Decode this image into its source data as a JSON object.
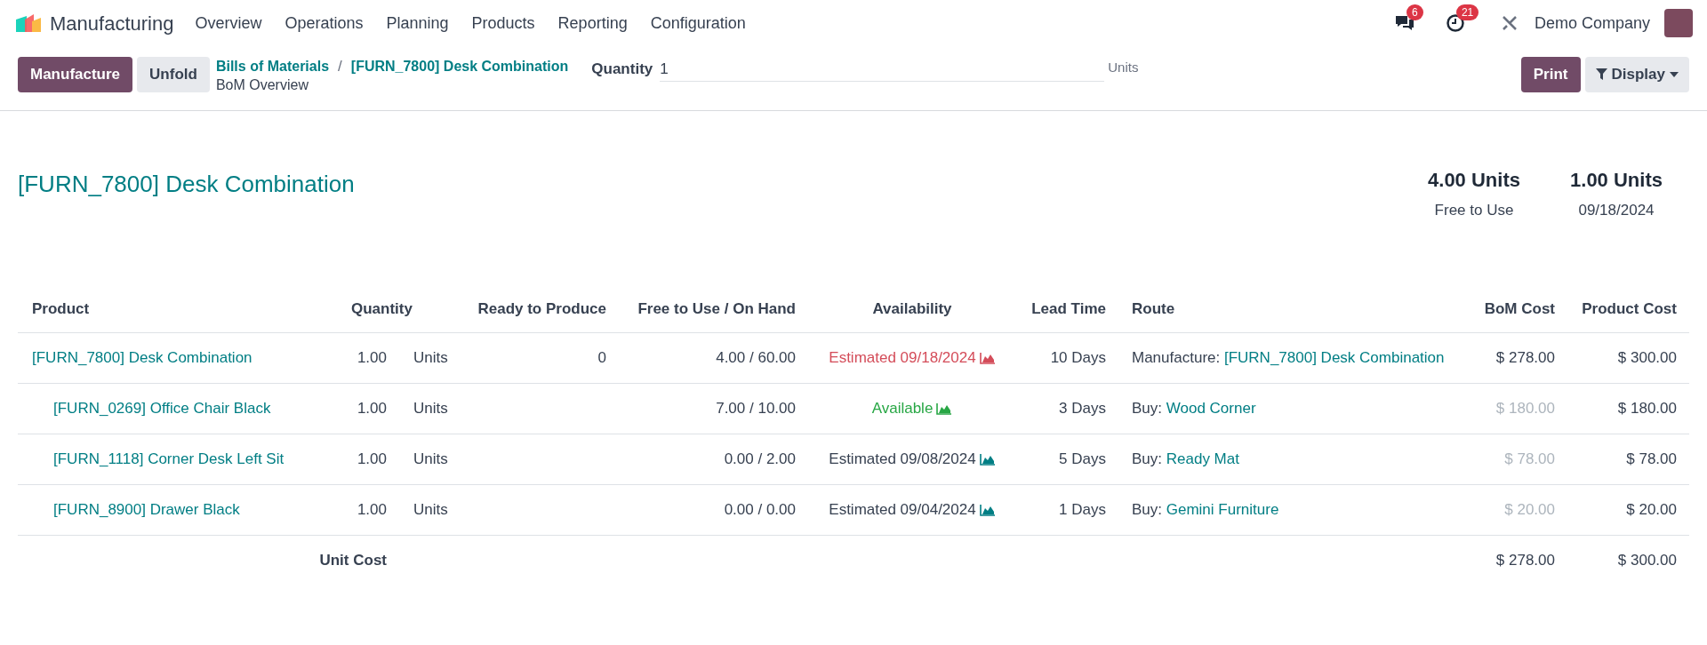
{
  "navbar": {
    "app_name": "Manufacturing",
    "menus": [
      "Overview",
      "Operations",
      "Planning",
      "Products",
      "Reporting",
      "Configuration"
    ],
    "messages_badge": "6",
    "activities_badge": "21",
    "company": "Demo Company"
  },
  "control_panel": {
    "buttons": [
      {
        "label": "Manufacture",
        "kind": "primary"
      },
      {
        "label": "Unfold",
        "kind": "secondary"
      }
    ],
    "breadcrumbs": [
      "Bills of Materials",
      "[FURN_7800] Desk Combination"
    ],
    "breadcrumb_separator": "/",
    "page_title": "BoM Overview",
    "quantity_label": "Quantity",
    "quantity_value": "1",
    "quantity_unit": "Units",
    "print": "Print",
    "display": "Display"
  },
  "header": {
    "title": "[FURN_7800] Desk Combination",
    "summaries": [
      {
        "value": "4.00 Units",
        "label": "Free to Use"
      },
      {
        "value": "1.00 Units",
        "label": "09/18/2024"
      }
    ]
  },
  "table": {
    "columns": [
      "Product",
      "Quantity",
      "Ready to Produce",
      "Free to Use / On Hand",
      "Availability",
      "Lead Time",
      "Route",
      "BoM Cost",
      "Product Cost"
    ],
    "rows": [
      {
        "product": "[FURN_7800] Desk Combination",
        "quantity": "1.00",
        "uom": "Units",
        "ready": "0",
        "free_on_hand": "4.00 / 60.00",
        "availability": "Estimated 09/18/2024",
        "kind": "late",
        "lead_time": "10 Days",
        "route_prefix": "Manufacture: ",
        "route_link": "[FURN_7800] Desk Combination",
        "bom_cost": "$ 278.00",
        "bom_cost_muted": false,
        "product_cost": "$ 300.00",
        "children": [
          {
            "product": "[FURN_0269] Office Chair Black",
            "quantity": "1.00",
            "uom": "Units",
            "free_on_hand": "7.00 / 10.00",
            "availability": "Available",
            "kind": "available",
            "lead_time": "3 Days",
            "route_prefix": "Buy: ",
            "route_link": "Wood Corner",
            "bom_cost": "$ 180.00",
            "bom_cost_muted": true,
            "product_cost": "$ 180.00"
          },
          {
            "product": "[FURN_1118] Corner Desk Left Sit",
            "quantity": "1.00",
            "uom": "Units",
            "free_on_hand": "0.00 / 2.00",
            "availability": "Estimated 09/08/2024",
            "kind": "estimated",
            "lead_time": "5 Days",
            "route_prefix": "Buy: ",
            "route_link": "Ready Mat",
            "bom_cost": "$ 78.00",
            "bom_cost_muted": true,
            "product_cost": "$ 78.00"
          },
          {
            "product": "[FURN_8900] Drawer Black",
            "quantity": "1.00",
            "uom": "Units",
            "free_on_hand": "0.00 / 0.00",
            "availability": "Estimated 09/04/2024",
            "kind": "estimated",
            "lead_time": "1 Days",
            "route_prefix": "Buy: ",
            "route_link": "Gemini Furniture",
            "bom_cost": "$ 20.00",
            "bom_cost_muted": true,
            "product_cost": "$ 20.00"
          }
        ]
      }
    ],
    "footer": {
      "label": "Unit Cost",
      "bom_cost": "$ 278.00",
      "product_cost": "$ 300.00"
    }
  }
}
